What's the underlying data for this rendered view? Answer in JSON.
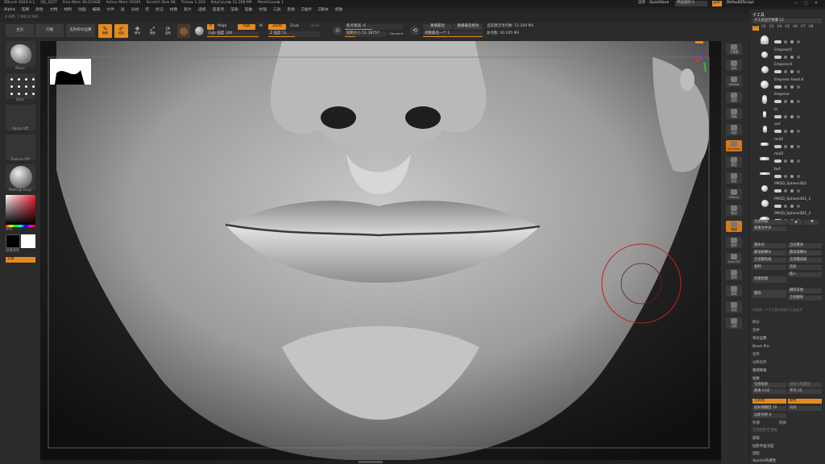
{
  "titlebar": {
    "app": "ZBrush 2024.0.1",
    "file": "QS_3227",
    "free_mem": "Free Mem 36.033GB",
    "active_mem": "Active Mem 19345",
    "scratch": "Scratch Disk 98",
    "timer": "Timer▸ 1.203",
    "polycount": "PolyCount▸ 12.269 MP",
    "meshcount": "MeshCount▸ 1",
    "menu_item": "菜单",
    "quicksave": "QuickSave",
    "transparency": "界面透明 0",
    "menus_btn": "菜单",
    "script": "DefaultZScript"
  },
  "menubar": [
    "Alpha",
    "笔刷",
    "颜色",
    "文档",
    "绘制",
    "动画",
    "编辑",
    "文件",
    "层",
    "光线",
    "宏",
    "标记",
    "材质",
    "影片",
    "选择",
    "首选项",
    "渲染",
    "笔触",
    "纹理",
    "工具",
    "变换",
    "Z插件",
    "Z脚本",
    "帮助"
  ],
  "infoline": "X 685, Y 881,0.081",
  "toolbar": {
    "home": "主页",
    "lightbox": "灯箱",
    "live_boolean": "实时布尔运算",
    "edit": "编辑",
    "draw": "绘制",
    "move": "移动",
    "scale": "缩放",
    "rotate": "旋转",
    "a": "A",
    "mrgb": "Mrgb",
    "rgb": "Rgb",
    "m": "M",
    "rgb_strength": "Rgb 强度 100",
    "zadd": "Zadd",
    "zsub": "Zsub",
    "zcut": "Zcut",
    "z_intensity": "Z 强度 51",
    "focal_shift": "焦点衰减 -6",
    "draw_size": "绘制大小 51.18757",
    "dynamic": "Dynamic",
    "replay_last": "重播最后",
    "replay_last_rel": "重播最后相对",
    "adjust_last": "调整最后一个 1",
    "active_points": "当前激活顶点数: 12.269 Mil",
    "total_points": "总点数: 30.205 Mil"
  },
  "leftshelf": {
    "brush": "Move",
    "stroke": "Dots",
    "alpha": "Alpha Off",
    "texture": "Texture Off",
    "material": "MatCap Gray",
    "gradient": "渐变",
    "switch_color": "切换颜色",
    "alternate": "交替",
    "main_color": "#ffffff",
    "secondary_color": "#000000"
  },
  "rightshelf": [
    "子像素",
    "实际",
    "AAHalf",
    "透视",
    "地板",
    "局部",
    "Dynamic",
    "模型",
    "锁定",
    "Gizmo",
    "移动",
    "缩放",
    "旋转",
    "Line Fill",
    "透明",
    "隔离",
    "双面",
    "边框"
  ],
  "panel": {
    "subtool_title": "子工具",
    "slider_label": "子工具显示数量 12",
    "v_tabs": [
      "V1",
      "V2",
      "V3",
      "V4",
      "V5",
      "V6",
      "V7",
      "V8"
    ],
    "subtools": [
      "",
      "Emperor5",
      "Emperor4",
      "Emperor head 8",
      "Emperor",
      "In",
      "out",
      "mid2",
      "mid2",
      "bot",
      "PM3D_Sphere3D2",
      "PM3D_Sphere3D1_1",
      "PM3D_Sphere3D1_2"
    ],
    "list_all": "全部列表",
    "new_folder": "新建文件夹",
    "rename": "重命名",
    "auto_rename": "自动重命",
    "lowest_res": "最低级细分",
    "highest_res": "最高级细分",
    "all_low": "全部最低级",
    "all_high": "全部最高级",
    "duplicate": "复制",
    "append": "追加",
    "insert": "插入",
    "create_new": "创建新建",
    "delete": "删除",
    "delete_other": "删除其他",
    "delete_all": "全部删除",
    "extract_hint": "将选择一个子工具与其他子工具合并",
    "split": "拆分",
    "merge": "合并",
    "boolean": "布尔运算",
    "bevel_pro": "Bevel Pro",
    "align": "对齐",
    "distribute": "分布对齐",
    "remesh_section": "重建网格",
    "project": "投射",
    "project_all": "全部投射",
    "project_geom": "投射几何模型",
    "distance": "距离 0.02",
    "mean": "平均 25",
    "geometry": "几何体",
    "color": "颜色",
    "project_blur": "投射模糊度 10",
    "inner": "向内",
    "far_outside": "远距外移 0",
    "outer": "外部",
    "inner2": "内部",
    "project_bpr": "全部投影至顶层",
    "extract": "提取",
    "proj_surface": "投影平面深度",
    "zoom_section": "适配",
    "xgen": "Xpolish的属性"
  }
}
